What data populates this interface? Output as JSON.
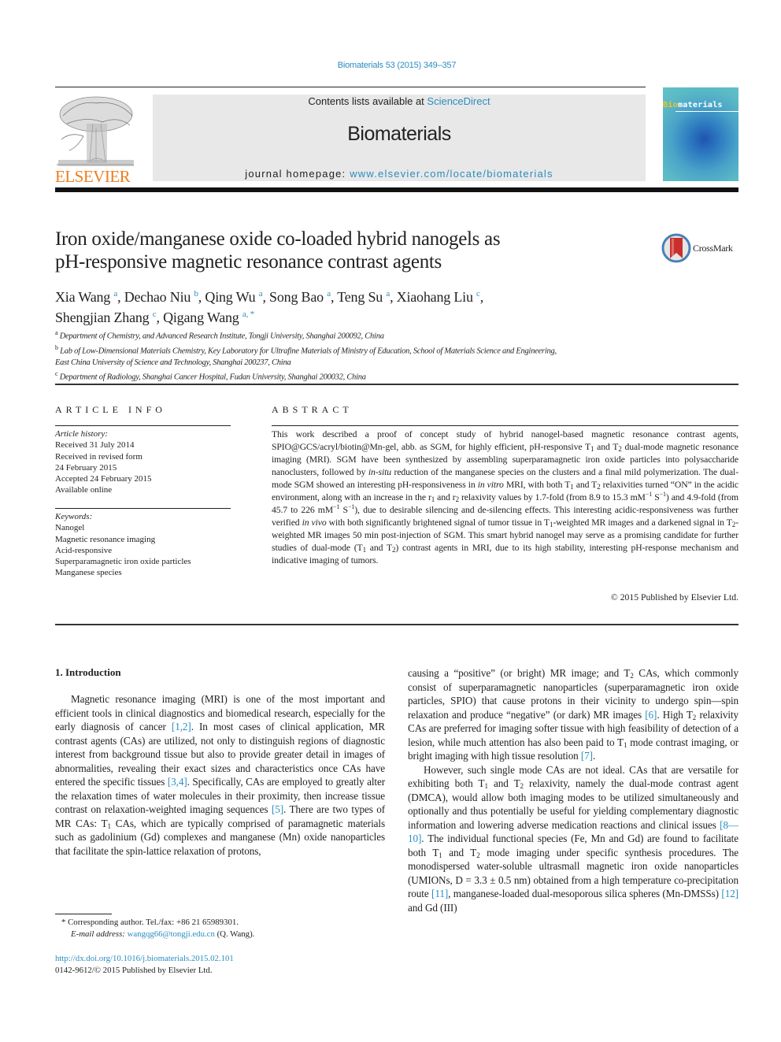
{
  "masthead": {
    "citation": "Biomaterials 53 (2015) 349–357",
    "contents_prefix": "Contents lists available at ",
    "contents_link": "ScienceDirect",
    "journal_name": "Biomaterials",
    "homepage_prefix": "journal homepage: ",
    "homepage_link": "www.elsevier.com/locate/biomaterials",
    "publisher_logo_text": "ELSEVIER",
    "cover_title_highlight": "Bio",
    "cover_title_rest": "materials",
    "brand_color": "#f07c1c",
    "link_color": "#2a8cbf"
  },
  "article": {
    "title_line1": "Iron oxide/manganese oxide co-loaded hybrid nanogels as",
    "title_line2": "pH-responsive magnetic resonance contrast agents",
    "crossmark_label": "CrossMark",
    "authors": [
      {
        "name": "Xia Wang",
        "aff": "a"
      },
      {
        "name": "Dechao Niu",
        "aff": "b"
      },
      {
        "name": "Qing Wu",
        "aff": "a"
      },
      {
        "name": "Song Bao",
        "aff": "a"
      },
      {
        "name": "Teng Su",
        "aff": "a"
      },
      {
        "name": "Xiaohang Liu",
        "aff": "c"
      },
      {
        "name": "Shengjian Zhang",
        "aff": "c"
      },
      {
        "name": "Qigang Wang",
        "aff": "a, *"
      }
    ],
    "affiliations": [
      {
        "key": "a",
        "text": "Department of Chemistry, and Advanced Research Institute, Tongji University, Shanghai 200092, China"
      },
      {
        "key": "b",
        "text": "Lab of Low-Dimensional Materials Chemistry, Key Laboratory for Ultrafine Materials of Ministry of Education, School of Materials Science and Engineering,"
      },
      {
        "key": "",
        "text": "East China University of Science and Technology, Shanghai 200237, China"
      },
      {
        "key": "c",
        "text": "Department of Radiology, Shanghai Cancer Hospital, Fudan University, Shanghai 200032, China"
      }
    ]
  },
  "article_info": {
    "heading": "ARTICLE INFO",
    "history_label": "Article history:",
    "history": [
      "Received 31 July 2014",
      "Received in revised form",
      "24 February 2015",
      "Accepted 24 February 2015",
      "Available online"
    ],
    "keywords_label": "Keywords:",
    "keywords": [
      "Nanogel",
      "Magnetic resonance imaging",
      "Acid-responsive",
      "Superparamagnetic iron oxide particles",
      "Manganese species"
    ]
  },
  "abstract": {
    "heading": "ABSTRACT",
    "t1": "This work described a proof of concept study of hybrid nanogel-based magnetic resonance contrast agents, SPIO@GCS/acryl/biotin@Mn-gel, abb. as SGM, for highly efficient, pH-responsive T",
    "t2": " and T",
    "t3": " dual-mode magnetic resonance imaging (MRI). SGM have been synthesized by assembling superparamagnetic iron oxide particles into polysaccharide nanoclusters, followed by ",
    "t4_italic": "in-situ",
    "t5": " reduction of the manganese species on the clusters and a final mild polymerization. The dual-mode SGM showed an interesting pH-responsiveness in ",
    "t6_italic": "in vitro",
    "t7": " MRI, with both T",
    "t8": " and T",
    "t9": " relaxivities turned “ON” in the acidic environment, along with an increase in the r",
    "t10": " and r",
    "t11": " relaxivity values by 1.7-fold (from 8.9 to 15.3 mM",
    "t12": " S",
    "t13": ") and 4.9-fold (from 45.7 to 226 mM",
    "t14": " S",
    "t15": "), due to desirable silencing and de-silencing effects. This interesting acidic-responsiveness was further verified ",
    "t16_italic": "in vivo",
    "t17": " with both significantly brightened signal of tumor tissue in T",
    "t18": "-weighted MR images and a darkened signal in T",
    "t19": "-weighted MR images 50 min post-injection of SGM. This smart hybrid nanogel may serve as a promising candidate for further studies of dual-mode (T",
    "t20": " and T",
    "t21": ") contrast agents in MRI, due to its high stability, interesting pH-response mechanism and indicative imaging of tumors.",
    "sub1": "1",
    "sub2": "2",
    "sup_neg1": "−1",
    "copyright": "© 2015 Published by Elsevier Ltd."
  },
  "intro": {
    "heading": "1.  Introduction",
    "p1a": "Magnetic resonance imaging (MRI) is one of the most important and efficient tools in clinical diagnostics and biomedical research, especially for the early diagnosis of cancer ",
    "ref1": "[1,2]",
    "p1b": ". In most cases of clinical application, MR contrast agents (CAs) are utilized, not only to distinguish regions of diagnostic interest from background tissue but also to provide greater detail in images of abnormalities, revealing their exact sizes and characteristics once CAs have entered the specific tissues ",
    "ref2": "[3,4]",
    "p1c": ". Specifically, CAs are employed to greatly alter the relaxation times of water molecules in their proximity, then increase tissue contrast on relaxation-weighted imaging sequences ",
    "ref3": "[5]",
    "p1d": ". There are two types of MR CAs: T",
    "p1e": " CAs, which are typically comprised of paramagnetic materials such as gadolinium (Gd) complexes and manganese (Mn) oxide nanoparticles that facilitate the spin-lattice relaxation of protons, causing a “positive” (or bright) MR image; and T",
    "p1f": " CAs, which commonly consist of superparamagnetic nanoparticles (superparamagnetic iron oxide particles, SPIO) that cause protons in their vicinity to undergo spin—spin relaxation and produce “negative” (or dark) MR images ",
    "ref4": "[6]",
    "p1g": ". High T",
    "p1h": " relaxivity CAs are preferred for imaging softer tissue with high feasibility of detection of a lesion, while much attention has also been paid to T",
    "p1i": " mode contrast imaging, or bright imaging with high tissue resolution ",
    "ref5": "[7]",
    "p1j": ".",
    "p2a": "However, such single mode CAs are not ideal. CAs that are versatile for exhibiting both T",
    "p2b": " and T",
    "p2c": " relaxivity, namely the dual-mode contrast agent (DMCA), would allow both imaging modes to be utilized simultaneously and optionally and thus potentially be useful for yielding complementary diagnostic information and lowering adverse medication reactions and clinical issues ",
    "ref6": "[8—10]",
    "p2d": ". The individual functional species (Fe, Mn and Gd) are found to facilitate both T",
    "p2e": " and T",
    "p2f": " mode imaging under specific synthesis procedures. The monodispersed water-soluble ultrasmall magnetic iron oxide nanoparticles (UMIONs, D = 3.3 ± 0.5 nm) obtained from a high temperature co-precipitation route ",
    "ref7": "[11]",
    "p2g": ", manganese-loaded dual-mesoporous silica spheres (Mn-DMSSs) ",
    "ref8": "[12]",
    "p2h": " and Gd (III)"
  },
  "footnotes": {
    "corresponding": "* Corresponding author. Tel./fax: +86 21 65989301.",
    "email_label": "E-mail address: ",
    "email": "wangqg66@tongji.edu.cn",
    "email_suffix": " (Q. Wang).",
    "doi": "http://dx.doi.org/10.1016/j.biomaterials.2015.02.101",
    "issn": "0142-9612/© 2015 Published by Elsevier Ltd."
  }
}
